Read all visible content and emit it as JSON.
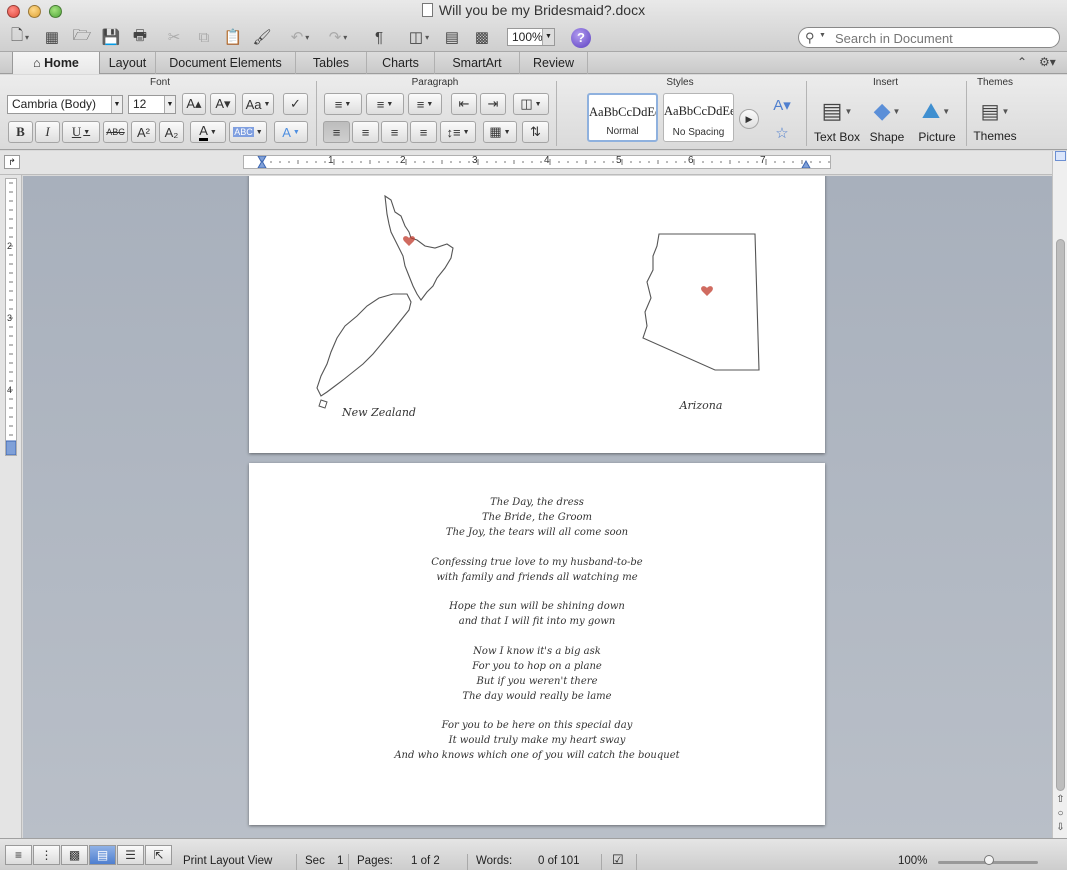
{
  "window": {
    "title": "Will you be my Bridesmaid?.docx"
  },
  "toolbar": {
    "zoom": "100%",
    "search_placeholder": "Search in Document",
    "icons": [
      "new-doc-icon",
      "templates-icon",
      "open-icon",
      "save-icon",
      "print-icon",
      "cut-icon",
      "copy-icon",
      "paste-icon",
      "format-painter-icon",
      "undo-icon",
      "redo-icon",
      "pilcrow-icon",
      "view-icon",
      "sidebar-icon",
      "media-browser-icon",
      "help-icon"
    ]
  },
  "ribbon": {
    "tabs": [
      "Home",
      "Layout",
      "Document Elements",
      "Tables",
      "Charts",
      "SmartArt",
      "Review"
    ],
    "active_tab": "Home",
    "groups": {
      "font": "Font",
      "paragraph": "Paragraph",
      "styles": "Styles",
      "insert": "Insert",
      "themes": "Themes"
    },
    "font_name": "Cambria (Body)",
    "font_size": "12",
    "styles": [
      {
        "sample": "AaBbCcDdEe",
        "name": "Normal"
      },
      {
        "sample": "AaBbCcDdEe",
        "name": "No Spacing"
      }
    ],
    "insert_buttons": [
      "Text Box",
      "Shape",
      "Picture"
    ],
    "themes_button": "Themes",
    "accent_color": "#4f7fcf"
  },
  "ruler": {
    "h_numbers": [
      "1",
      "2",
      "3",
      "4",
      "5",
      "6",
      "7"
    ],
    "v_numbers": [
      "2",
      "3",
      "4"
    ]
  },
  "document": {
    "page1": {
      "map_left_label": "New Zealand",
      "map_right_label": "Arizona",
      "heart_color": "#c0392b"
    },
    "poem": [
      [
        "The Day, the dress",
        "The Bride, the Groom",
        "The Joy, the tears will all come soon"
      ],
      [
        "Confessing true love to my husband-to-be",
        "with family and friends all watching me"
      ],
      [
        "Hope the sun will be shining down",
        "and that I will fit into my gown"
      ],
      [
        "Now I know it's a big ask",
        "For you to hop on a plane",
        "But if you weren't there",
        "The day would really be lame"
      ],
      [
        "For you to be here on this special day",
        "It would truly make my heart sway",
        "And who knows which one of you will catch the bouquet"
      ]
    ]
  },
  "status": {
    "view": "Print Layout View",
    "sec_label": "Sec",
    "sec_value": "1",
    "pages_label": "Pages:",
    "pages_value": "1 of 2",
    "words_label": "Words:",
    "words_value": "0 of 101",
    "zoom": "100%",
    "zoom_level_percent": 100
  }
}
